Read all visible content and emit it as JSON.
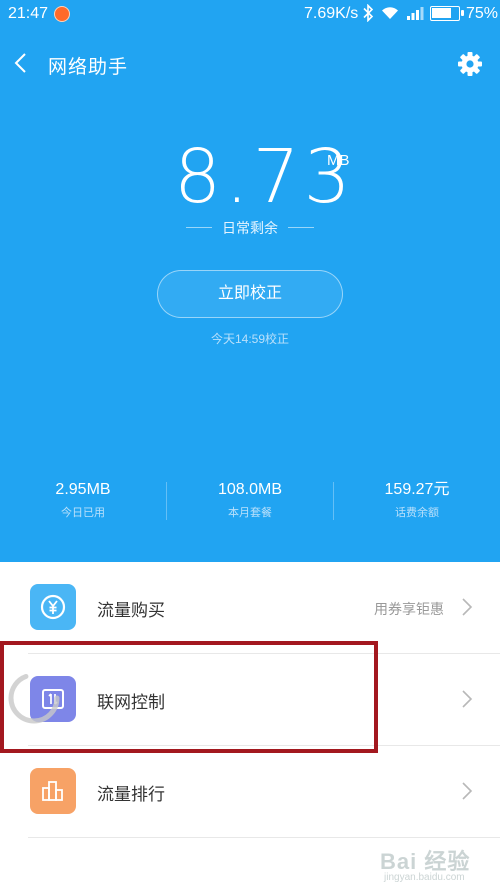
{
  "status_bar": {
    "time": "21:47",
    "network_speed": "7.69K/s",
    "battery_percent": "75%",
    "battery_level": 0.75,
    "icons": [
      "app-notification-icon",
      "bluetooth-icon",
      "wifi-icon",
      "signal-icon",
      "battery-icon"
    ]
  },
  "header": {
    "title": "网络助手",
    "back_icon": "back-arrow-icon",
    "settings_icon": "gear-icon"
  },
  "usage": {
    "value": "8.73",
    "unit": "MB",
    "caption": "日常剩余"
  },
  "calibrate": {
    "button_label": "立即校正",
    "last_calibrated": "今天14:59校正"
  },
  "stats": [
    {
      "value": "2.95MB",
      "label": "今日已用"
    },
    {
      "value": "108.0MB",
      "label": "本月套餐"
    },
    {
      "value": "159.27元",
      "label": "话费余额"
    }
  ],
  "list": [
    {
      "label": "流量购买",
      "hint": "用券享钜惠",
      "icon": "yen-coin-icon",
      "icon_color": "#4ab6f5"
    },
    {
      "label": "联网控制",
      "hint": "",
      "icon": "network-control-icon",
      "icon_color": "#7e86e8"
    },
    {
      "label": "流量排行",
      "hint": "",
      "icon": "bar-chart-icon",
      "icon_color": "#f7a266"
    }
  ],
  "colors": {
    "hero_background": "#21a4f2",
    "highlight_border": "#a3181f"
  },
  "watermark": {
    "text": "Bai 经验",
    "url": "jingyan.baidu.com"
  }
}
